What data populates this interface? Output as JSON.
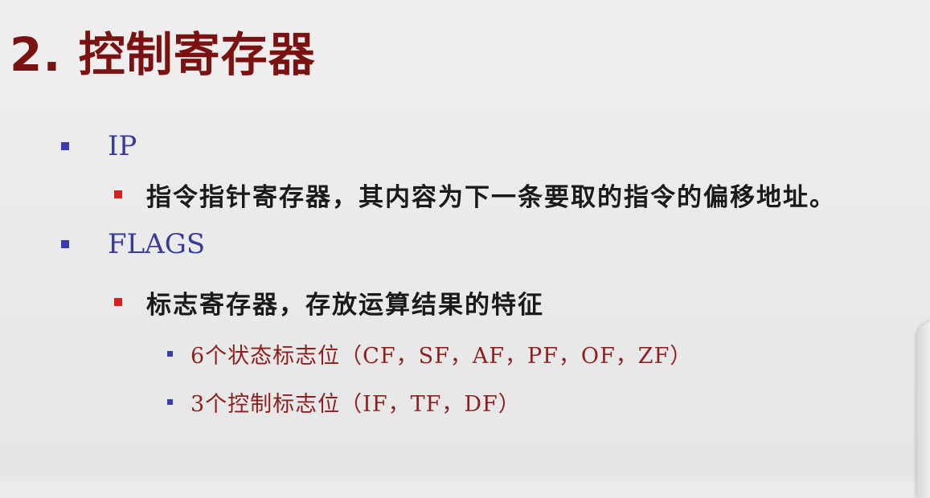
{
  "title": "2. 控制寄存器",
  "items": [
    {
      "label": "IP",
      "sub": [
        {
          "label": "指令指针寄存器，其内容为下一条要取的指令的偏移地址。"
        }
      ]
    },
    {
      "label": "FLAGS",
      "sub": [
        {
          "label": "标志寄存器，存放运算结果的特征",
          "sub": [
            {
              "label": "6个状态标志位（CF，SF，AF，PF，OF，ZF）"
            },
            {
              "label": "3个控制标志位（IF，TF，DF）"
            }
          ]
        }
      ]
    }
  ],
  "colors": {
    "title": "#7a1212",
    "level1_bullet": "#3b3bb0",
    "level2_bullet": "#d42020",
    "level3_text": "#8e1f1f"
  }
}
